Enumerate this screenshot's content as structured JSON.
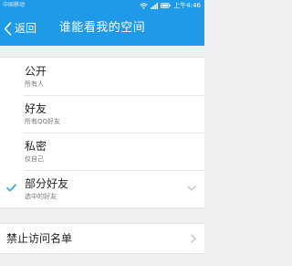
{
  "status_bar": {
    "carrier": "中国移动",
    "time": "上午4:46"
  },
  "nav": {
    "back_label": "返回",
    "title": "谁能看我的空间"
  },
  "options": [
    {
      "title": "公开",
      "subtitle": "所有人",
      "selected": false
    },
    {
      "title": "好友",
      "subtitle": "所有QQ好友",
      "selected": false
    },
    {
      "title": "私密",
      "subtitle": "仅自己",
      "selected": false
    },
    {
      "title": "部分好友",
      "subtitle": "选中的好友",
      "selected": true
    }
  ],
  "blocklist": {
    "label": "禁止访问名单"
  },
  "colors": {
    "accent": "#1e9ae8",
    "background": "#f0f0f3",
    "row": "#ffffff"
  },
  "icons": {
    "back": "chevron-left-icon",
    "selected": "check-icon",
    "expand": "chevron-down-icon",
    "navigate": "chevron-right-icon",
    "wifi": "wifi-icon",
    "signal": "signal-icon",
    "battery": "battery-icon"
  }
}
